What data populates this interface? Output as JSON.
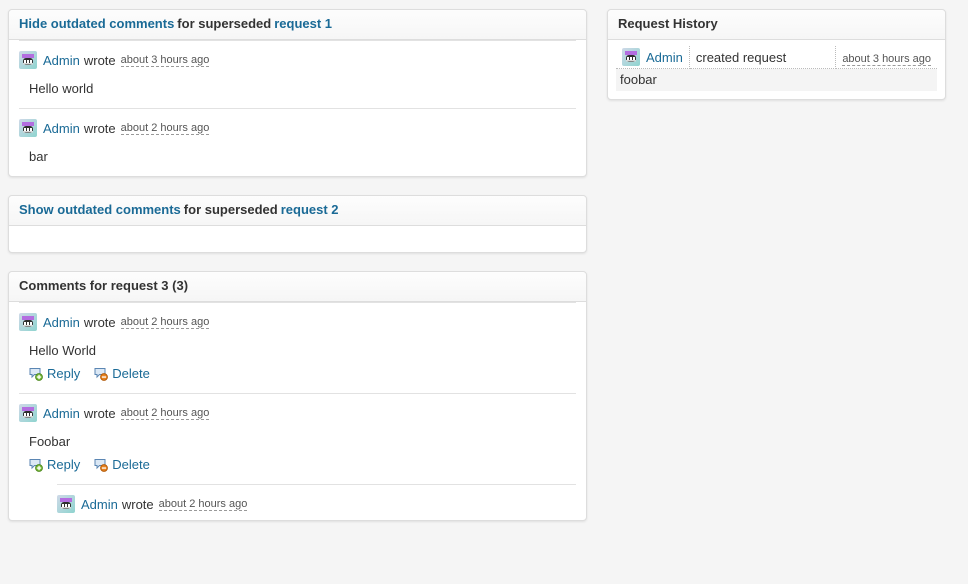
{
  "colors": {
    "link": "#1a6a96",
    "text": "#333333",
    "page_bg": "#f5f5f5",
    "panel_bg": "#ffffff",
    "panel_border": "#dddddd",
    "divider": "#e2e2e2",
    "detail_row_bg": "#f4f4f4"
  },
  "panels": {
    "outdated_1": {
      "toggle_label": "Hide outdated comments",
      "middle_text": "for superseded",
      "request_link": "request 1",
      "comments": [
        {
          "author": "Admin",
          "wrote": "wrote",
          "timestamp": "about 3 hours ago",
          "body": "Hello world",
          "avatar_name": "user-avatar-icon"
        },
        {
          "author": "Admin",
          "wrote": "wrote",
          "timestamp": "about 2 hours ago",
          "body": "bar",
          "avatar_name": "user-avatar-icon"
        }
      ]
    },
    "outdated_2": {
      "toggle_label": "Show outdated comments",
      "middle_text": "for superseded",
      "request_link": "request 2",
      "comments": []
    },
    "comments_3": {
      "title": "Comments for request 3 (3)",
      "actions": {
        "reply_label": "Reply",
        "delete_label": "Delete",
        "reply_icon": "comment-add-icon",
        "delete_icon": "comment-remove-icon"
      },
      "comments": [
        {
          "author": "Admin",
          "wrote": "wrote",
          "timestamp": "about 2 hours ago",
          "body": "Hello World",
          "avatar_name": "user-avatar-icon"
        },
        {
          "author": "Admin",
          "wrote": "wrote",
          "timestamp": "about 2 hours ago",
          "body": "Foobar",
          "avatar_name": "user-avatar-icon"
        }
      ],
      "nested_comment": {
        "author": "Admin",
        "wrote": "wrote",
        "timestamp": "about 2 hours ago",
        "avatar_name": "user-avatar-icon"
      }
    }
  },
  "history": {
    "title": "Request History",
    "rows": [
      {
        "user": "Admin",
        "action": "created request",
        "timestamp": "about 3 hours ago",
        "detail": "foobar",
        "avatar_name": "user-avatar-icon"
      }
    ]
  }
}
